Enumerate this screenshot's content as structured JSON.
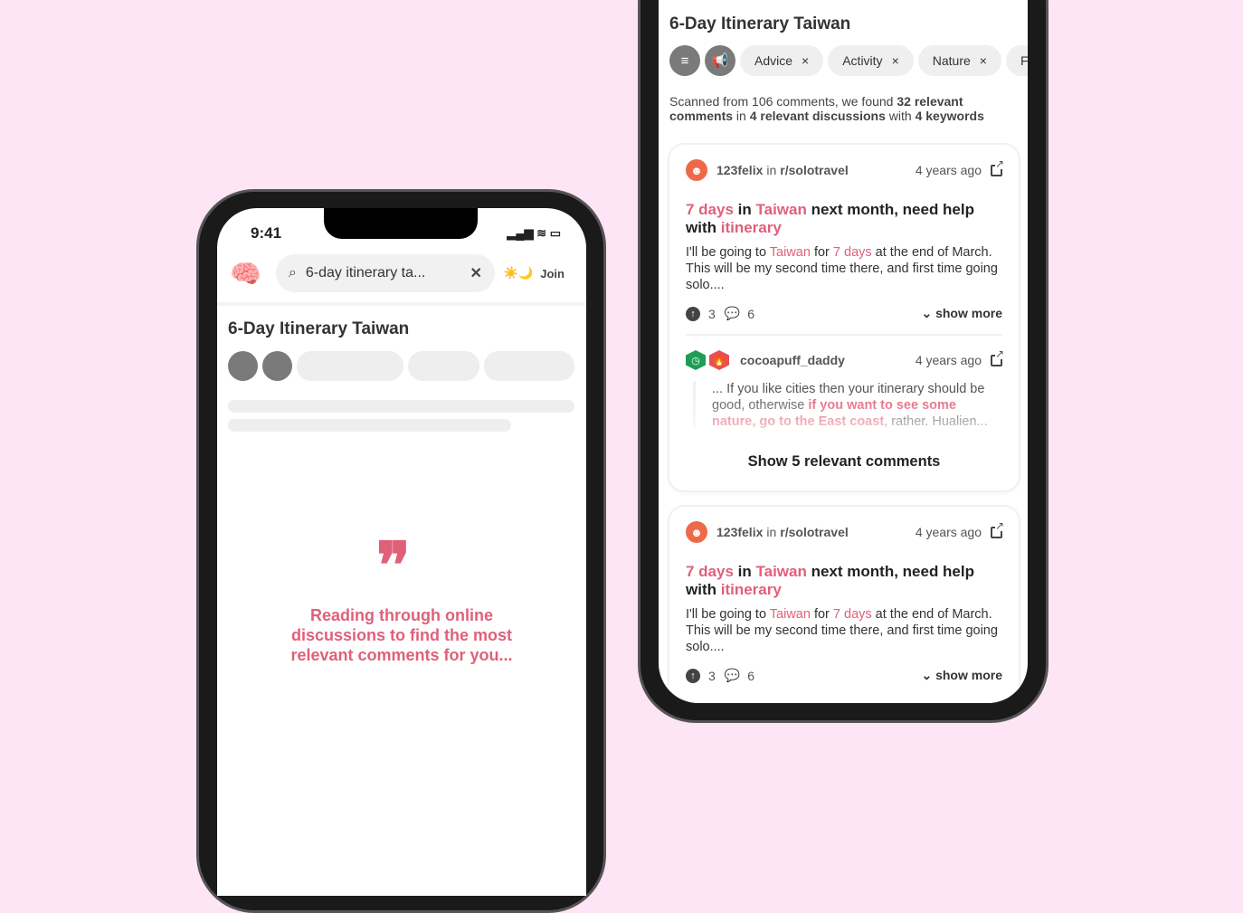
{
  "left_phone": {
    "status": {
      "time": "9:41"
    },
    "header": {
      "search_value": "6-day itinerary ta...",
      "join_label": "Join",
      "sun_icon": "☀️",
      "moon_icon": "🌙"
    },
    "page_title": "6-Day Itinerary Taiwan",
    "loading": {
      "quote_icon": "quote-icon",
      "message": "Reading through online discussions to find the most relevant comments for you..."
    }
  },
  "right_phone": {
    "page_title": "6-Day Itinerary Taiwan",
    "chips": [
      "Advice",
      "Activity",
      "Nature",
      "F"
    ],
    "summary": {
      "p1": "Scanned from 106 comments, we found ",
      "b1": "32 relevant comments",
      "p2": " in ",
      "b2": "4 relevant discussions",
      "p3": " with ",
      "b3": "4 keywords"
    },
    "cards": [
      {
        "user": "123felix",
        "in": "in",
        "subreddit": "r/solotravel",
        "time": "4 years ago",
        "title": [
          {
            "t": "7 days",
            "hl": true
          },
          {
            "t": " in ",
            "hl": false
          },
          {
            "t": "Taiwan",
            "hl": true
          },
          {
            "t": " next month, need help with ",
            "hl": false
          },
          {
            "t": "itinerary",
            "hl": true
          }
        ],
        "body": [
          {
            "t": "I'll be going to ",
            "hl": false
          },
          {
            "t": "Taiwan",
            "hl": true
          },
          {
            "t": " for ",
            "hl": false
          },
          {
            "t": "7 days",
            "hl": true
          },
          {
            "t": " at the end of March. This will be my second time there, and first time going solo....",
            "hl": false
          }
        ],
        "upvotes": "3",
        "comments": "6",
        "show_more": "show more",
        "reply": {
          "user": "cocoapuff_daddy",
          "time": "4 years ago",
          "p1": "... If you like cities then your itinerary should be good, otherwise ",
          "hl": "if you want to see some nature, go to the East coast",
          "p2": ", rather. Hualien..."
        },
        "show_comments": "Show 5 relevant comments"
      },
      {
        "user": "123felix",
        "in": "in",
        "subreddit": "r/solotravel",
        "time": "4 years ago",
        "title": [
          {
            "t": "7 days",
            "hl": true
          },
          {
            "t": " in ",
            "hl": false
          },
          {
            "t": "Taiwan",
            "hl": true
          },
          {
            "t": " next month, need help with ",
            "hl": false
          },
          {
            "t": "itinerary",
            "hl": true
          }
        ],
        "body": [
          {
            "t": "I'll be going to ",
            "hl": false
          },
          {
            "t": "Taiwan",
            "hl": true
          },
          {
            "t": " for ",
            "hl": false
          },
          {
            "t": "7 days",
            "hl": true
          },
          {
            "t": " at the end of March. This will be my second time there, and first time going solo....",
            "hl": false
          }
        ],
        "upvotes": "3",
        "comments": "6",
        "show_more": "show more"
      }
    ]
  },
  "colors": {
    "accent": "#e0607a",
    "background": "#fde5f6"
  }
}
